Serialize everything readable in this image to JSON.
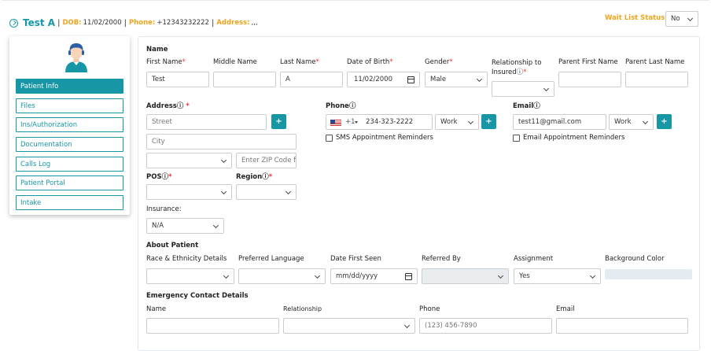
{
  "header": {
    "name": "Test A",
    "separator": "|",
    "dob_label": "DOB:",
    "dob": "11/02/2000",
    "phone_label": "Phone:",
    "phone": "+12343232222",
    "address_label": "Address:",
    "address": ",,,",
    "wait_list_label": "Wait List Status:",
    "wait_list_value": "No"
  },
  "sidebar": {
    "items": [
      {
        "label": "Patient Info",
        "active": true
      },
      {
        "label": "Files",
        "active": false
      },
      {
        "label": "Ins/Authorization",
        "active": false
      },
      {
        "label": "Documentation",
        "active": false
      },
      {
        "label": "Calls Log",
        "active": false
      },
      {
        "label": "Patient Portal",
        "active": false
      },
      {
        "label": "Intake",
        "active": false
      }
    ]
  },
  "form": {
    "name_section": "Name",
    "first_name_label": "First Name",
    "first_name": "Test",
    "middle_name_label": "Middle Name",
    "middle_name": "",
    "last_name_label": "Last Name",
    "last_name": "A",
    "dob_label": "Date of Birth",
    "dob": "11/02/2000",
    "gender_label": "Gender",
    "gender": "Male",
    "relationship_label_1": "Relationship to",
    "relationship_label_2": "Insured",
    "relationship": "",
    "parent_first_label": "Parent First Name",
    "parent_last_label": "Parent Last Name",
    "address_label": "Address",
    "street_placeholder": "Street",
    "city_placeholder": "City",
    "state": "",
    "zip_placeholder": "Enter ZIP Code f",
    "phone_label": "Phone",
    "phone_country_code": "+1",
    "phone_number": "234-323-2222",
    "phone_type": "Work",
    "sms_label": "SMS Appointment Reminders",
    "email_label": "Email",
    "email": "test11@gmail.com",
    "email_type": "Work",
    "email_reminder_label": "Email Appointment Reminders",
    "pos_label": "POS",
    "pos": "",
    "region_label": "Region",
    "region": "",
    "insurance_label": "Insurance:",
    "insurance": "N/A",
    "plus_symbol": "+",
    "required_mark": "*",
    "help_mark": "ⓘ"
  },
  "about": {
    "section": "About Patient",
    "race_label": "Race & Ethnicity Details",
    "language_label": "Preferred Language",
    "date_seen_label": "Date First Seen",
    "date_seen_placeholder": "mm/dd/yyyy",
    "referred_label": "Referred By",
    "assignment_label": "Assignment",
    "assignment": "Yes",
    "bgcolor_label": "Background Color",
    "bgcolor_value": "#e4ecf2"
  },
  "emergency": {
    "section": "Emergency Contact Details",
    "name_label": "Name",
    "relationship_label": "Relationship",
    "phone_label": "Phone",
    "phone_placeholder": "(123) 456-7890",
    "email_label": "Email"
  },
  "colors": {
    "accent": "#1797a6",
    "label_orange": "#f0a41e",
    "required_red": "#e0333c"
  }
}
